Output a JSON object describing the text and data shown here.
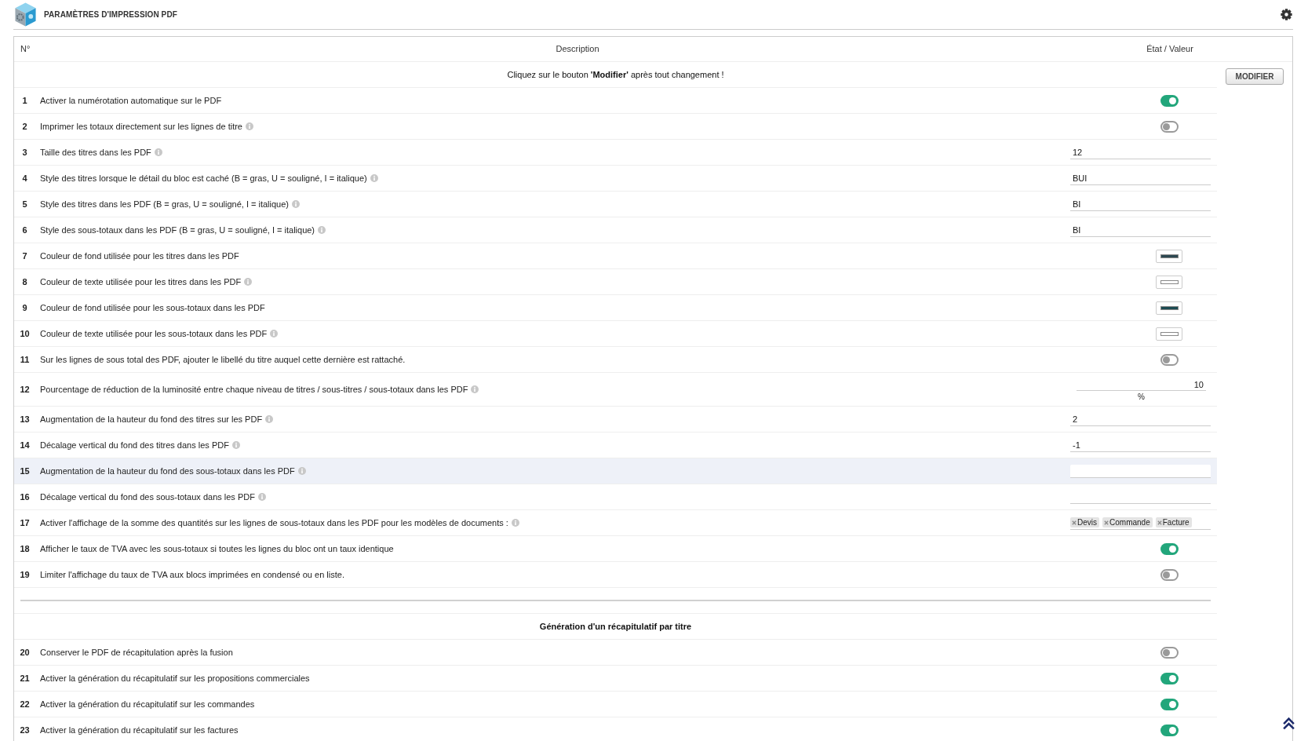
{
  "header": {
    "title": "PARAMÈTRES D'IMPRESSION PDF"
  },
  "table": {
    "columns": [
      "N°",
      "Description",
      "État / Valeur"
    ],
    "notice": "Cliquez sur le bouton **'Modifier'** après tout changement !",
    "submit_button": "MODIFIER",
    "sections": [
      {
        "rows": [
          {
            "number": "1",
            "label": "Activer la numérotation automatique sur le PDF",
            "info": false,
            "kind": "toggle",
            "on": true,
            "highlighted": false
          },
          {
            "number": "2",
            "label": "Imprimer les totaux directement sur les lignes de titre",
            "info": true,
            "kind": "toggle",
            "on": false,
            "highlighted": false
          },
          {
            "number": "3",
            "label": "Taille des titres dans les PDF",
            "info": true,
            "kind": "text",
            "value": "12",
            "highlighted": false
          },
          {
            "number": "4",
            "label": "Style des titres lorsque le détail du bloc est caché (B = gras, U = souligné, I = italique)",
            "info": true,
            "kind": "text",
            "value": "BUI",
            "highlighted": false
          },
          {
            "number": "5",
            "label": "Style des titres dans les PDF (B = gras, U = souligné, I = italique)",
            "info": true,
            "kind": "text",
            "value": "BI",
            "highlighted": false
          },
          {
            "number": "6",
            "label": "Style des sous-totaux dans les PDF (B = gras, U = souligné, I = italique)",
            "info": true,
            "kind": "text",
            "value": "BI",
            "highlighted": false
          },
          {
            "number": "7",
            "label": "Couleur de fond utilisée pour les titres dans les PDF",
            "info": false,
            "kind": "color",
            "color": "#2d4851",
            "highlighted": false
          },
          {
            "number": "8",
            "label": "Couleur de texte utilisée pour les titres dans les PDF",
            "info": true,
            "kind": "color",
            "color": "#ffffff",
            "highlighted": false
          },
          {
            "number": "9",
            "label": "Couleur de fond utilisée pour les sous-totaux dans les PDF",
            "info": false,
            "kind": "color",
            "color": "#1c4b52",
            "highlighted": false
          },
          {
            "number": "10",
            "label": "Couleur de texte utilisée pour les sous-totaux dans les PDF",
            "info": true,
            "kind": "color",
            "color": "#ffffff",
            "highlighted": false
          },
          {
            "number": "11",
            "label": "Sur les lignes de sous total des PDF, ajouter le libellé du titre auquel cette dernière est rattaché.",
            "info": false,
            "kind": "toggle",
            "on": false,
            "highlighted": false
          },
          {
            "number": "12",
            "label": "Pourcentage de réduction de la luminosité entre chaque niveau de titres / sous-titres / sous-totaux dans les PDF",
            "info": true,
            "kind": "percent",
            "value": "10",
            "unit": "%",
            "highlighted": false
          },
          {
            "number": "13",
            "label": "Augmentation de la hauteur du fond des titres sur les PDF",
            "info": true,
            "kind": "text",
            "value": "2",
            "highlighted": false
          },
          {
            "number": "14",
            "label": "Décalage vertical du fond des titres dans les PDF",
            "info": true,
            "kind": "text",
            "value": "-1",
            "highlighted": false
          },
          {
            "number": "15",
            "label": "Augmentation de la hauteur du fond des sous-totaux dans les PDF",
            "info": true,
            "kind": "text",
            "highlighted": true
          },
          {
            "number": "16",
            "label": "Décalage vertical du fond des sous-totaux dans les PDF",
            "info": true,
            "kind": "text",
            "highlighted": false
          },
          {
            "number": "17",
            "label": "Activer l'affichage de la somme des quantités sur les lignes de sous-totaux dans les PDF pour les modèles de documents :",
            "info": true,
            "kind": "tags",
            "tags": [
              "Devis",
              "Commande",
              "Facture"
            ],
            "highlighted": false
          },
          {
            "number": "18",
            "label": "Afficher le taux de TVA avec les sous-totaux si toutes les lignes du bloc ont un taux identique",
            "info": false,
            "kind": "toggle",
            "on": true,
            "highlighted": false
          },
          {
            "number": "19",
            "label": "Limiter l'affichage du taux de TVA aux blocs imprimées en condensé ou en liste.",
            "info": false,
            "kind": "toggle",
            "on": false,
            "highlighted": false
          }
        ]
      },
      {
        "title": "Génération d'un récapitulatif par titre",
        "rows": [
          {
            "number": "20",
            "label": "Conserver le PDF de récapitulation après la fusion",
            "info": false,
            "kind": "toggle",
            "on": false,
            "highlighted": false
          },
          {
            "number": "21",
            "label": "Activer la génération du récapitulatif sur les propositions commerciales",
            "info": false,
            "kind": "toggle",
            "on": true,
            "highlighted": false
          },
          {
            "number": "22",
            "label": "Activer la génération du récapitulatif sur les commandes",
            "info": false,
            "kind": "toggle",
            "on": true,
            "highlighted": false
          },
          {
            "number": "23",
            "label": "Activer la génération du récapitulatif sur les factures",
            "info": false,
            "kind": "toggle",
            "on": true,
            "highlighted": false
          }
        ]
      }
    ]
  }
}
